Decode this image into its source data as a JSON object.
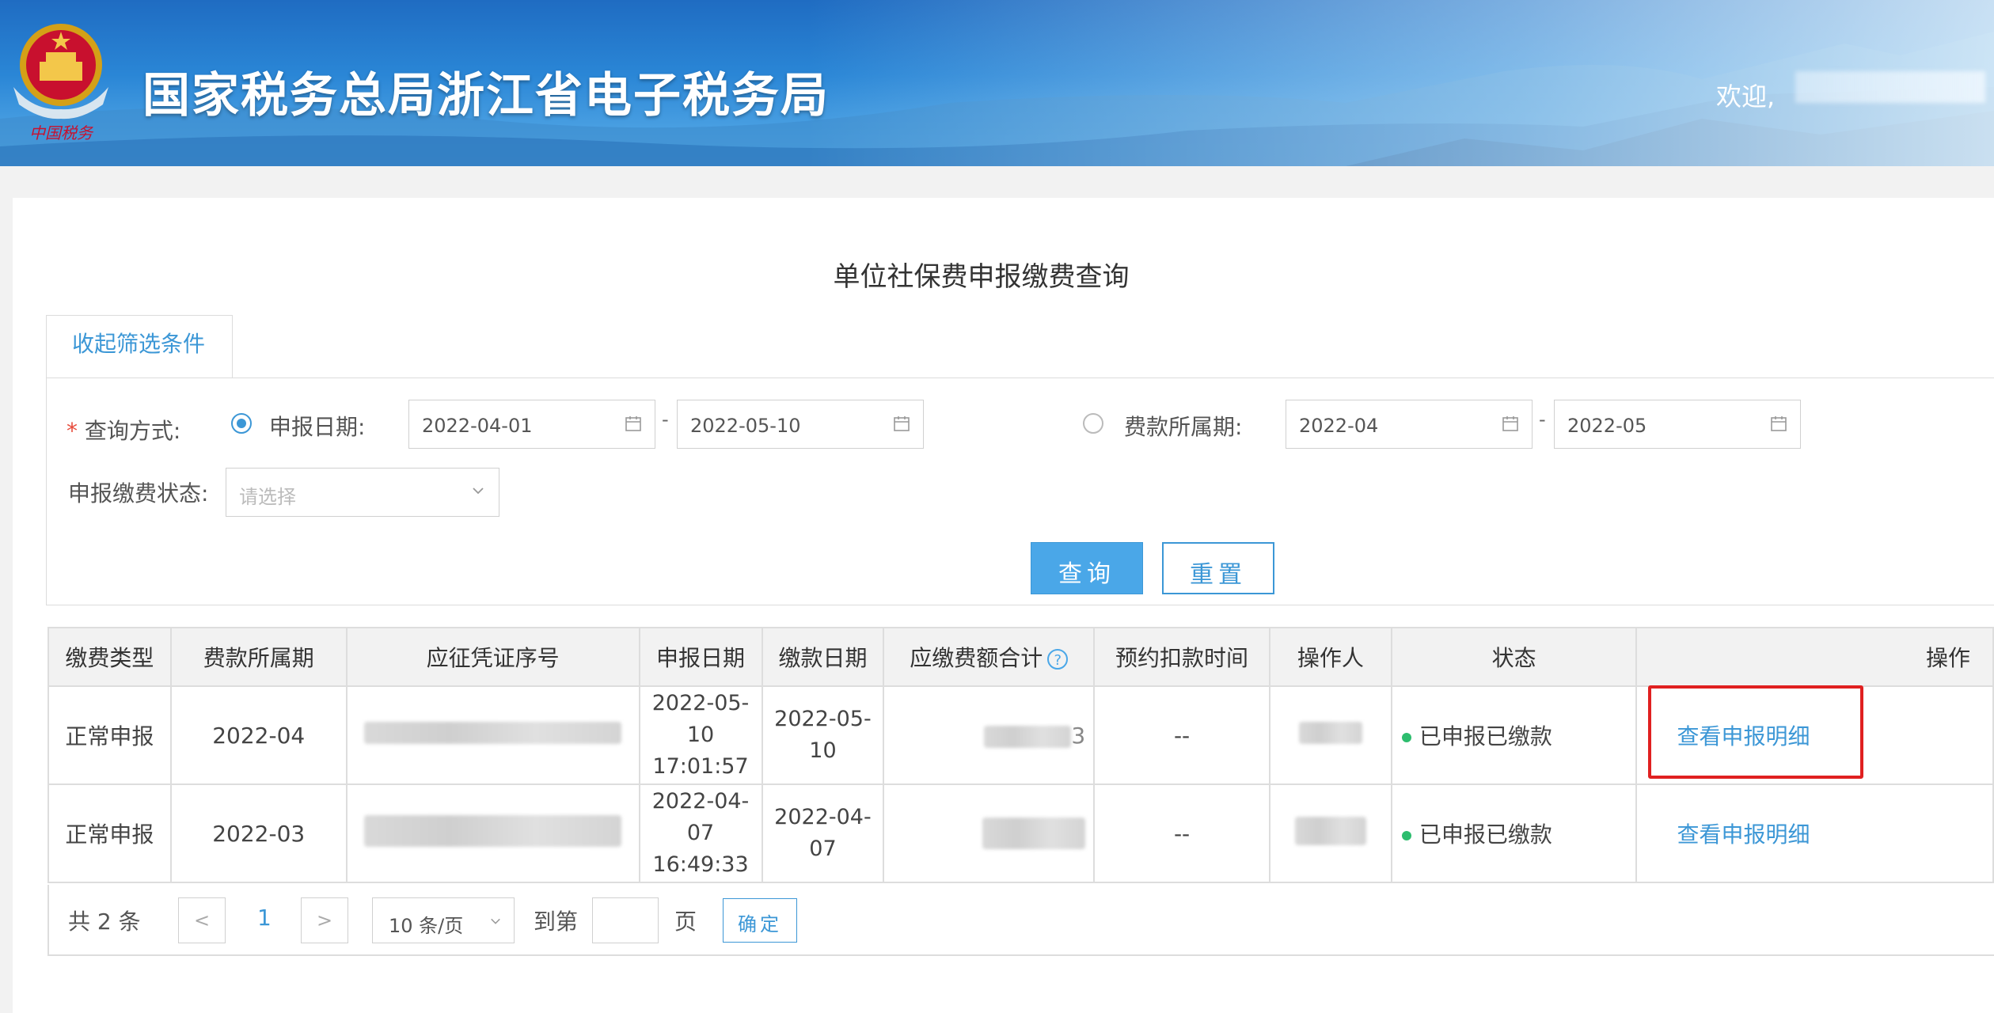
{
  "header": {
    "title": "国家税务总局浙江省电子税务局",
    "welcome": "欢迎,",
    "emblem_caption": "中国税务"
  },
  "page": {
    "title": "单位社保费申报缴费查询"
  },
  "filters": {
    "toggle_label": "收起筛选条件",
    "query_method_label": "查询方式:",
    "required_mark": "*",
    "option_declare_date": "申报日期:",
    "declare_date_from": "2022-04-01",
    "declare_date_to": "2022-05-10",
    "option_fee_period": "费款所属期:",
    "fee_period_from": "2022-04",
    "fee_period_to": "2022-05",
    "separator": "-",
    "status_label": "申报缴费状态:",
    "status_placeholder": "请选择",
    "search_button": "查询",
    "reset_button": "重置"
  },
  "table": {
    "headers": [
      "缴费类型",
      "费款所属期",
      "应征凭证序号",
      "申报日期",
      "缴款日期",
      "应缴费额合计",
      "预约扣款时间",
      "操作人",
      "状态",
      "操作"
    ],
    "help_icon": "?",
    "rows": [
      {
        "type": "正常申报",
        "period": "2022-04",
        "declare_date": [
          "2022-05-",
          "10",
          "17:01:57"
        ],
        "pay_date": [
          "2022-05-",
          "10"
        ],
        "amount_suffix": "3",
        "deduct_time": "--",
        "status": "已申报已缴款",
        "action": "查看申报明细"
      },
      {
        "type": "正常申报",
        "period": "2022-03",
        "declare_date": [
          "2022-04-",
          "07",
          "16:49:33"
        ],
        "pay_date": [
          "2022-04-",
          "07"
        ],
        "amount_suffix": "",
        "deduct_time": "--",
        "status": "已申报已缴款",
        "action": "查看申报明细"
      }
    ]
  },
  "pagination": {
    "total_prefix": "共",
    "total_count": "2",
    "total_suffix": "条",
    "prev": "<",
    "current_page": "1",
    "next": ">",
    "page_size": "10 条/页",
    "goto_label": "到第",
    "page_unit": "页",
    "confirm": "确定"
  },
  "colors": {
    "accent": "#3c97d6",
    "primary_button": "#4aa7e8",
    "highlight_box": "#e02020",
    "status_dot": "#2dbd6e"
  }
}
